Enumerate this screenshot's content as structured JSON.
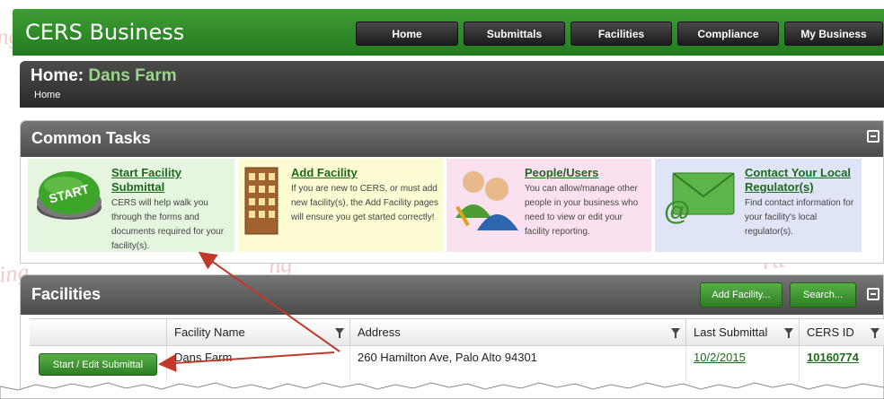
{
  "header": {
    "app_title": "CERS Business",
    "nav": [
      "Home",
      "Submittals",
      "Facilities",
      "Compliance",
      "My Business"
    ]
  },
  "home": {
    "title_prefix": "Home:",
    "business_name": "Dans Farm",
    "breadcrumb": "Home"
  },
  "common_tasks": {
    "title": "Common Tasks",
    "start_badge": "START",
    "items": [
      {
        "link": "Start Facility Submittal",
        "desc": "CERS will help walk you through the forms and documents required for your facility(s).",
        "bg": "#e6f5e0",
        "icon": "start-button-icon"
      },
      {
        "link": "Add Facility",
        "desc": "If you are new to CERS, or must add new facility(s), the Add Facility pages will ensure you get started correctly!",
        "bg": "#fdfbd2",
        "icon": "building-icon"
      },
      {
        "link": "People/Users",
        "desc": "You can allow/manage other people in your business who need to view or edit your facility reporting.",
        "bg": "#fbe1ef",
        "icon": "users-icon"
      },
      {
        "link": "Contact Your Local Regulator(s)",
        "desc": "Find contact information for your facility's local regulator(s).",
        "bg": "#dfe4f7",
        "icon": "email-icon"
      }
    ]
  },
  "facilities": {
    "title": "Facilities",
    "add_button": "Add Facility...",
    "search_button": "Search...",
    "columns": [
      "Facility Name",
      "Address",
      "Last Submittal",
      "CERS ID"
    ],
    "rows": [
      {
        "action": "Start / Edit Submittal",
        "facility_name": "Dans Farm",
        "address": "260 Hamilton Ave, Palo Alto 94301",
        "last_submittal": "10/2/2015",
        "cers_id": "10160774"
      }
    ]
  },
  "colors": {
    "brand_green": "#2d8a27",
    "annotation_arrow": "#c0392b"
  }
}
